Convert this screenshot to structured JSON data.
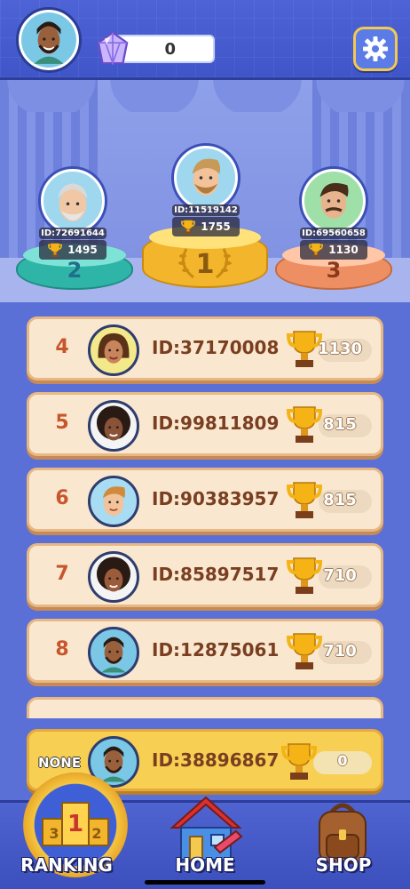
{
  "header": {
    "gem_count": "0",
    "avatar": "player-avatar",
    "settings_icon": "gear-icon",
    "gem_icon": "gem-icon"
  },
  "podium": [
    {
      "place": "1",
      "id": "ID:11519142",
      "score": "1755"
    },
    {
      "place": "2",
      "id": "ID:72691644",
      "score": "1495"
    },
    {
      "place": "3",
      "id": "ID:69560658",
      "score": "1130"
    }
  ],
  "list": [
    {
      "rank": "4",
      "id": "ID:37170008",
      "score": "1130"
    },
    {
      "rank": "5",
      "id": "ID:99811809",
      "score": "815"
    },
    {
      "rank": "6",
      "id": "ID:90383957",
      "score": "815"
    },
    {
      "rank": "7",
      "id": "ID:85897517",
      "score": "710"
    },
    {
      "rank": "8",
      "id": "ID:12875061",
      "score": "710"
    }
  ],
  "me": {
    "rank": "NONE",
    "id": "ID:38896867",
    "score": "0"
  },
  "nav": {
    "ranking": "RANKING",
    "home": "HOME",
    "shop": "SHOP",
    "badge_digits": [
      "3",
      "1",
      "2"
    ]
  },
  "colors": {
    "accent": "#4d63d6",
    "row_bg": "#f9e8cf",
    "me_row_bg": "#f7cf52",
    "rank_text": "#c8562d"
  }
}
